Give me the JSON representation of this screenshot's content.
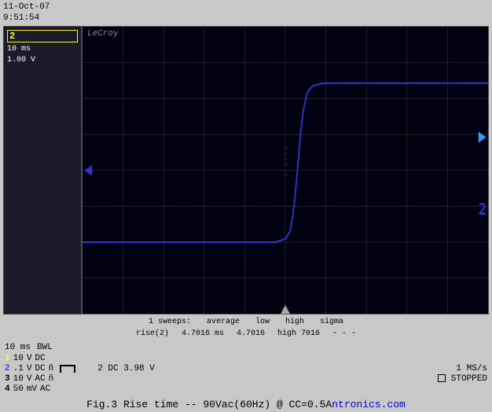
{
  "header": {
    "date": "11-Oct-07",
    "time": "9:51:54"
  },
  "scope": {
    "brand": "LeCroy",
    "ch2_label": "2",
    "timebase": "10 ms",
    "voltage": "1.00 V",
    "grid_cols": 10,
    "grid_rows": 8
  },
  "stats": {
    "sweeps": "1 sweeps:",
    "labels": {
      "avg": "average",
      "low": "low",
      "high": "high",
      "sigma": "sigma"
    },
    "measurement": "rise(2)",
    "avg_val": "4.7016 ms",
    "low_val": "4.7016",
    "high_val": "7016",
    "sigma_val": "- - -"
  },
  "bottom": {
    "timebase": "10 ms",
    "bwl": "BWL",
    "ch1": {
      "num": "1",
      "voltage": "10",
      "unit": "V",
      "coupling": "DC"
    },
    "ch2": {
      "num": "2",
      "voltage": ".1",
      "unit": "V",
      "coupling": "DC",
      "flag": "ñ"
    },
    "ch3": {
      "num": "3",
      "voltage": "10",
      "unit": "V",
      "coupling": "AC",
      "flag": "ñ"
    },
    "ch4": {
      "num": "4",
      "voltage": "50",
      "unit": "mV",
      "coupling": "AC"
    },
    "ch2_dc": "2 DC 3.98 V",
    "sample_rate": "1 MS/s",
    "status": "STOPPED"
  },
  "caption": "Fig.3  Rise time  --  90Vac(60Hz) @  CC=0.5A",
  "caption_brand": "ntronics.com"
}
